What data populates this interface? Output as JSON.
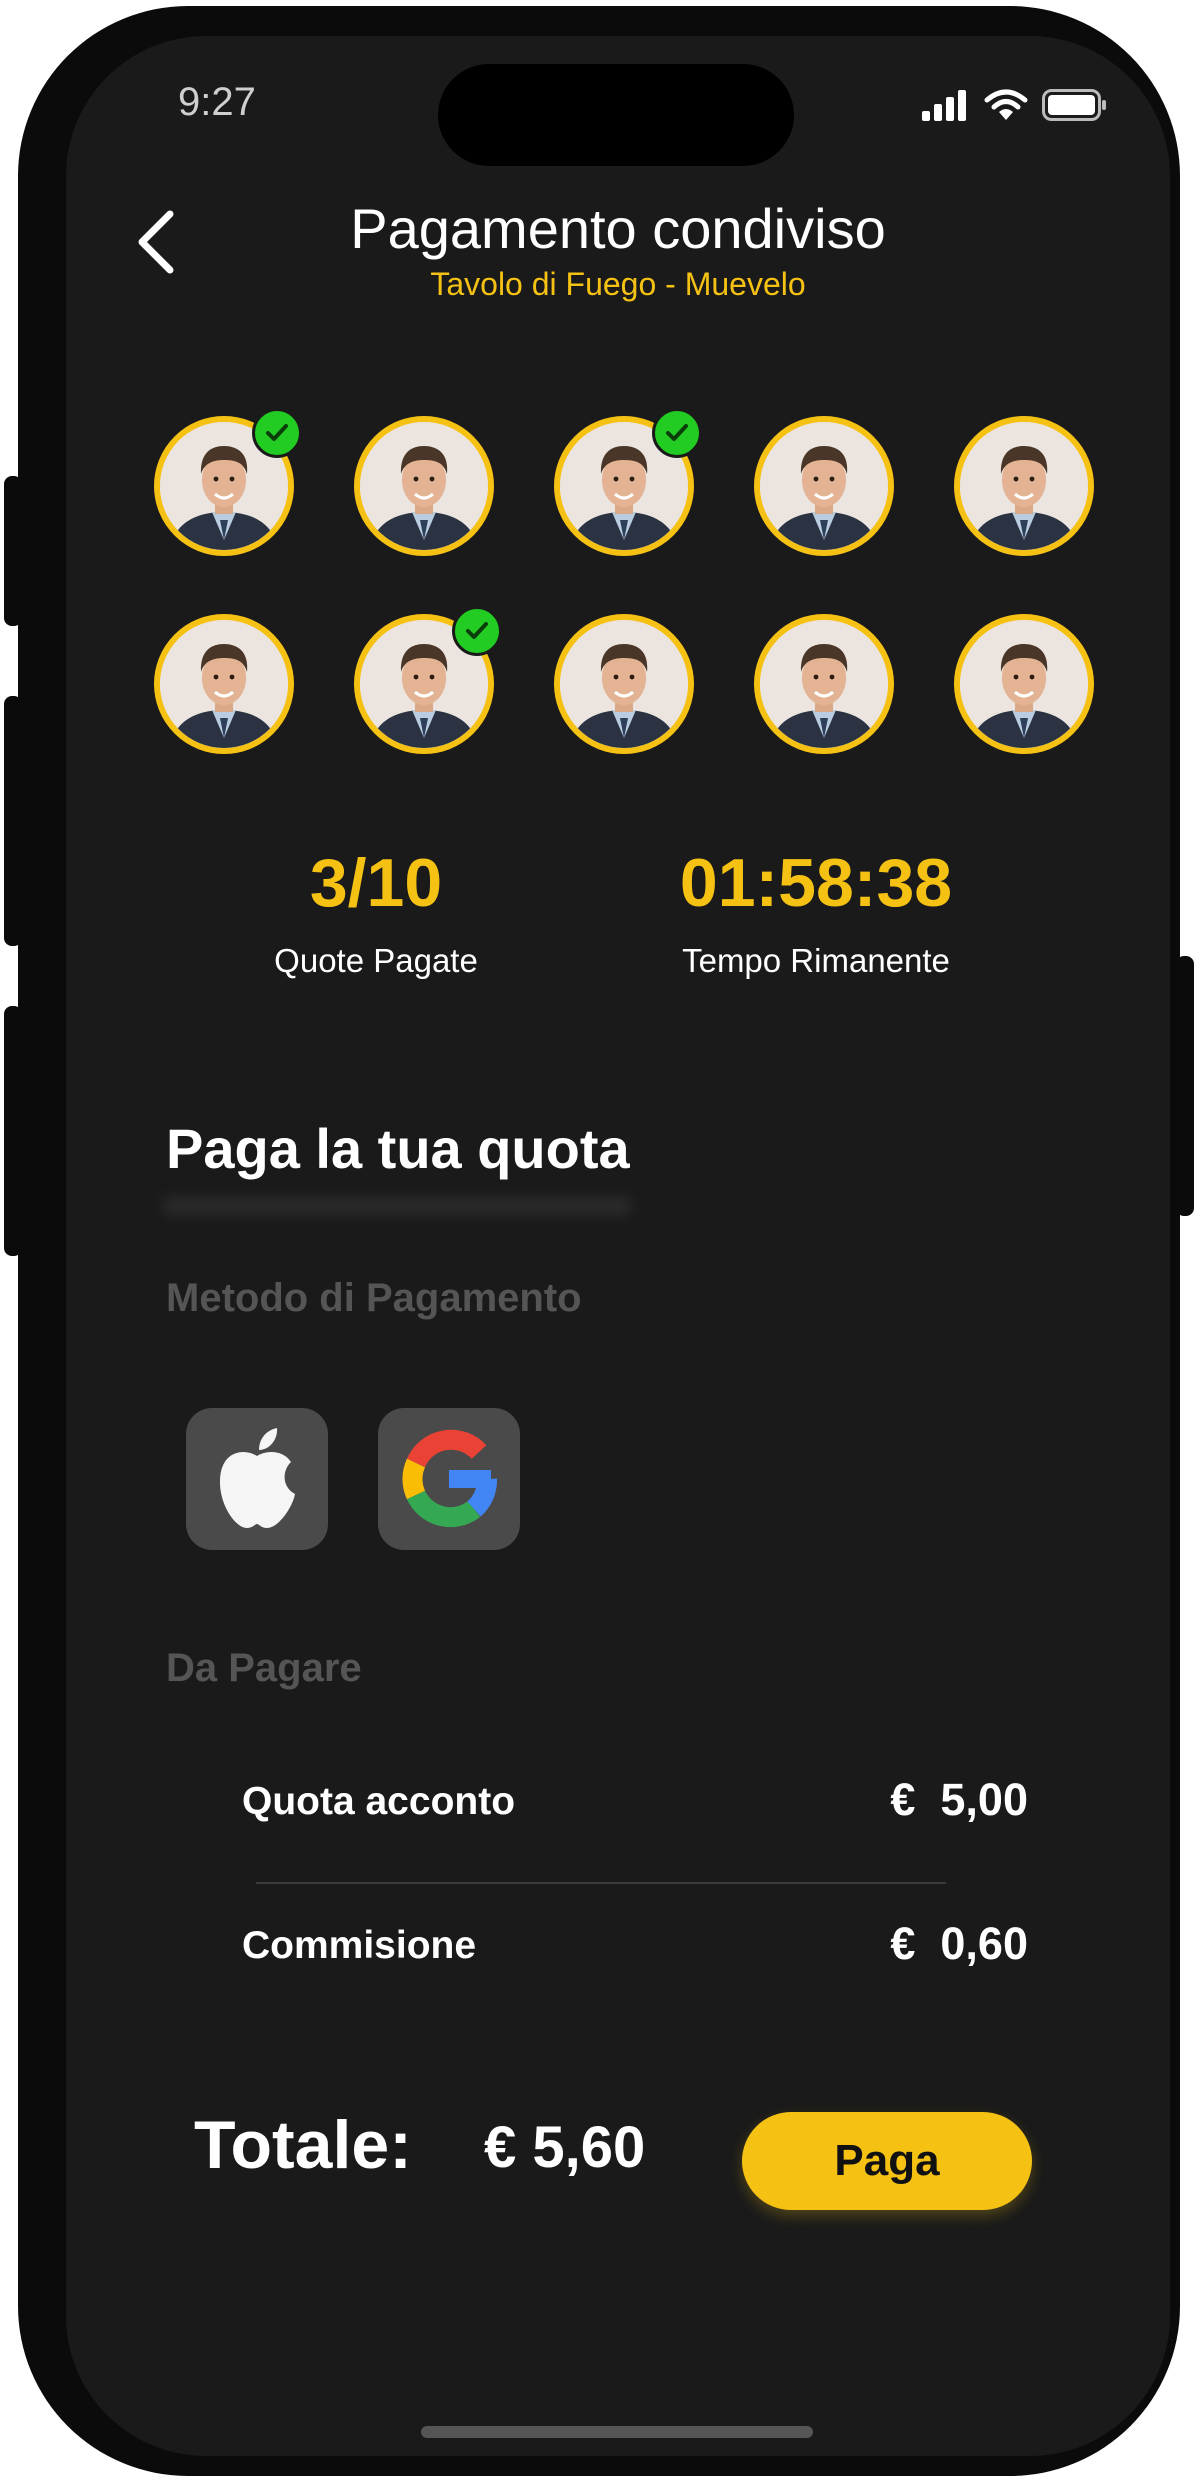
{
  "status_bar": {
    "time": "9:27"
  },
  "header": {
    "title": "Pagamento condiviso",
    "subtitle": "Tavolo di Fuego - Muevelo"
  },
  "participants": [
    {
      "paid": true
    },
    {
      "paid": false
    },
    {
      "paid": true
    },
    {
      "paid": false
    },
    {
      "paid": false
    },
    {
      "paid": false
    },
    {
      "paid": true
    },
    {
      "paid": false
    },
    {
      "paid": false
    },
    {
      "paid": false
    }
  ],
  "stats": {
    "quote_value": "3/10",
    "quote_label": "Quote Pagate",
    "time_value": "01:58:38",
    "time_label": "Tempo Rimanente"
  },
  "section": {
    "heading": "Paga la tua quota",
    "method_label": "Metodo di Pagamento",
    "methods": [
      {
        "icon": "apple-icon"
      },
      {
        "icon": "google-icon"
      }
    ],
    "due_label": "Da Pagare"
  },
  "rows": [
    {
      "label": "Quota acconto",
      "value": "€  5,00"
    },
    {
      "label": "Commisione",
      "value": "€  0,60"
    }
  ],
  "total": {
    "label": "Totale:",
    "value": "€ 5,60"
  },
  "pay_button": {
    "label": "Paga"
  },
  "colors": {
    "accent": "#f5c214",
    "background": "#1a1a1a",
    "check": "#22cc22"
  }
}
